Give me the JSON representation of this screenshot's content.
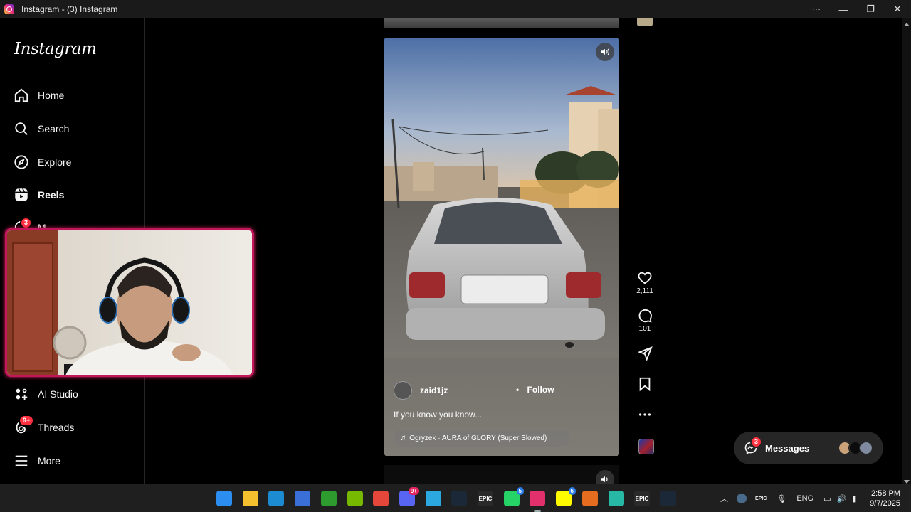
{
  "window": {
    "title": "Instagram - (3) Instagram",
    "more": "⋯",
    "minimize": "—",
    "maximize": "❐",
    "close": "✕"
  },
  "sidebar": {
    "logo": "Instagram",
    "items": [
      {
        "label": "Home",
        "icon": "home-icon"
      },
      {
        "label": "Search",
        "icon": "search-icon"
      },
      {
        "label": "Explore",
        "icon": "compass-icon"
      },
      {
        "label": "Reels",
        "icon": "reels-icon",
        "active": true
      },
      {
        "label": "M",
        "icon": "messenger-icon",
        "badge": "3"
      },
      {
        "label": "AI Studio",
        "icon": "ai-studio-icon"
      },
      {
        "label": "Threads",
        "icon": "threads-icon",
        "badge": "9+"
      },
      {
        "label": "More",
        "icon": "menu-icon"
      }
    ]
  },
  "reel": {
    "username": "zaid1jz",
    "follow_sep": "•",
    "follow_label": "Follow",
    "caption": "If you know you know...",
    "music": "Ogryzek · AURA of GLORY (Super Slowed)",
    "likes": "2,111",
    "comments": "101"
  },
  "messages": {
    "label": "Messages",
    "badge": "3"
  },
  "taskbar": {
    "icons": [
      {
        "name": "windows-start-icon",
        "color": "#2b8ef0"
      },
      {
        "name": "file-explorer-icon",
        "color": "#f4c02d"
      },
      {
        "name": "edge-icon",
        "color": "#1d8bd1"
      },
      {
        "name": "microsoft-store-icon",
        "color": "#3a6fd8"
      },
      {
        "name": "xbox-icon",
        "color": "#2d9b2d"
      },
      {
        "name": "nvidia-icon",
        "color": "#76b900"
      },
      {
        "name": "chrome-icon",
        "color": "#e5483a"
      },
      {
        "name": "discord-icon",
        "color": "#5865f2",
        "badge": "9+"
      },
      {
        "name": "browser-icon",
        "color": "#2ca8e0"
      },
      {
        "name": "steam-icon",
        "color": "#1b2838"
      },
      {
        "name": "epic-games-icon",
        "color": "#2a2a2a",
        "text": "EPIC"
      },
      {
        "name": "whatsapp-icon",
        "color": "#25d366",
        "badge": "5"
      },
      {
        "name": "instagram-icon",
        "color": "#e1306c",
        "active": true
      },
      {
        "name": "snapchat-icon",
        "color": "#fffc00",
        "badge": "6"
      },
      {
        "name": "affinity-icon",
        "color": "#e66d1f"
      },
      {
        "name": "app-icon",
        "color": "#28b9a6"
      },
      {
        "name": "epic-games-icon",
        "color": "#2a2a2a",
        "text": "EPIC"
      },
      {
        "name": "steam-icon",
        "color": "#1b2838"
      }
    ],
    "tray_lang": "ENG",
    "time": "2:58 PM",
    "date": "9/7/2025"
  }
}
